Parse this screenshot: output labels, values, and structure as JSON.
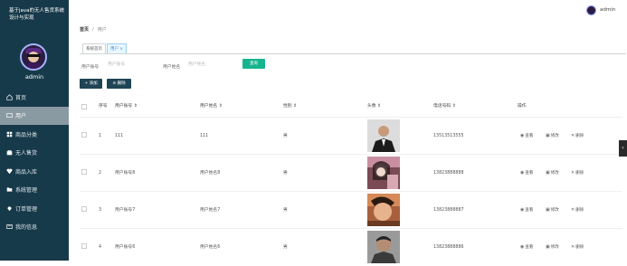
{
  "sidebar": {
    "title": "基于java的无人售货系统设计与实现",
    "username": "admin",
    "items": [
      {
        "label": "首页",
        "icon": "home-icon",
        "active": false
      },
      {
        "label": "用户",
        "icon": "user-icon",
        "active": true
      },
      {
        "label": "商品分类",
        "icon": "grid-icon",
        "active": false
      },
      {
        "label": "无人售货",
        "icon": "bag-icon",
        "active": false
      },
      {
        "label": "商品入库",
        "icon": "heart-icon",
        "active": false
      },
      {
        "label": "系统管理",
        "icon": "folder-icon",
        "active": false
      },
      {
        "label": "订单管理",
        "icon": "pin-icon",
        "active": false
      },
      {
        "label": "我的信息",
        "icon": "card-icon",
        "active": false
      }
    ]
  },
  "header": {
    "username": "admin"
  },
  "breadcrumb": {
    "home": "首页",
    "sep": "/",
    "current": "用户"
  },
  "tabs": [
    {
      "label": "系统首页"
    },
    {
      "label": "用户 ×"
    }
  ],
  "search": {
    "account_label": "用户账号",
    "account_placeholder": "用户账号",
    "name_label": "用户姓名",
    "name_placeholder": "用户姓名",
    "query_button": "查询"
  },
  "actions": {
    "add": "+ 添加",
    "delete": "删除"
  },
  "table": {
    "headers": {
      "index": "序号",
      "account": "用户账号 ⇕",
      "name": "用户姓名 ⇕",
      "gender": "性别 ⇕",
      "avatar": "头像 ⇕",
      "phone": "电话号码 ⇕",
      "ops": "操作"
    },
    "op_labels": {
      "view": "查看",
      "edit": "修改",
      "delete": "删除"
    },
    "rows": [
      {
        "index": "1",
        "account": "111",
        "name": "111",
        "gender": "男",
        "phone": "13513513555",
        "photo": "suit"
      },
      {
        "index": "2",
        "account": "用户账号8",
        "name": "用户姓名8",
        "gender": "男",
        "phone": "13823888888",
        "photo": "pink"
      },
      {
        "index": "3",
        "account": "用户账号7",
        "name": "用户姓名7",
        "gender": "男",
        "phone": "13823888887",
        "photo": "warm"
      },
      {
        "index": "4",
        "account": "用户账号6",
        "name": "用户姓名6",
        "gender": "男",
        "phone": "13823888886",
        "photo": "gray"
      }
    ]
  },
  "colors": {
    "sidebar_bg": "#173a4a",
    "accent": "#16b48e",
    "dark_button": "#1f4454"
  }
}
